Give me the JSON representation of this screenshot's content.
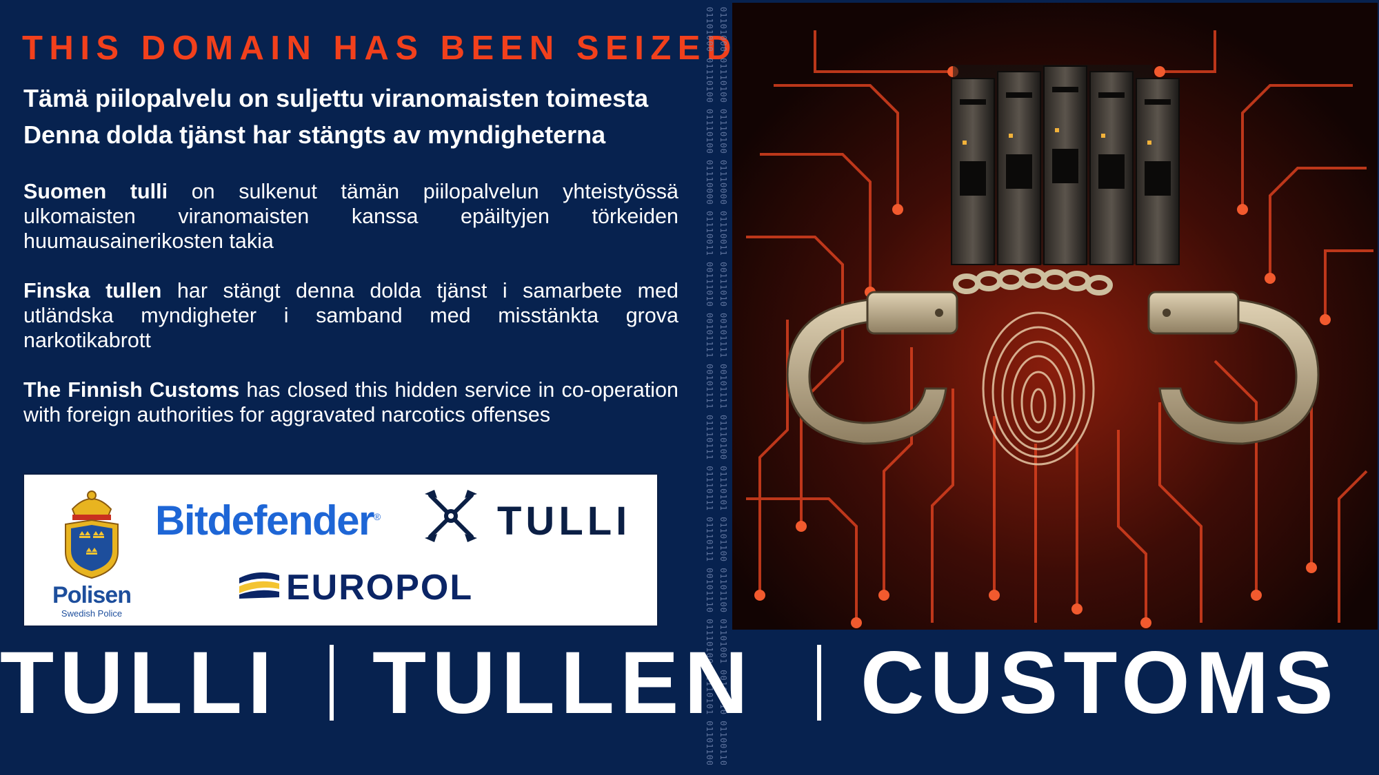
{
  "headline": "THIS DOMAIN HAS BEEN SEIZED",
  "subtitles": {
    "finnish": "Tämä piilopalvelu on suljettu viranomaisten toimesta",
    "swedish": "Denna dolda tjänst har stängts av myndigheterna"
  },
  "paragraphs": {
    "finnish": {
      "lead": "Suomen tulli",
      "body": " on sulkenut tämän piilopalvelun yhteistyössä ulkomaisten viranomaisten kanssa epäiltyjen törkeiden huumausainerikosten takia"
    },
    "swedish": {
      "lead": "Finska tullen",
      "body": " har stängt denna dolda tjänst i samarbete  med utländska myndigheter i samband med misstänkta grova narkotikabrott"
    },
    "english": {
      "lead": "The Finnish Customs",
      "body": " has closed this hidden service in co-operation with foreign authorities for aggravated narcotics offenses"
    }
  },
  "logos": {
    "police_name": "Polisen",
    "police_sub": "Swedish Police",
    "bitdefender": "Bitdefender",
    "bitdefender_mark": "®",
    "tulli": "TULLI",
    "europol": "EUROPOL"
  },
  "binary": {
    "line1": "01101000 01110100 01110100 01110000 01110011 00111010 00101111 00101111 01110111 01110111 01110111 00101110 01110100 01110101 01101100 01101100 01101001 00101110 01100110 01101001",
    "line2": "01101000 01110100 01110100 01110000 01110011 00111010 00101111 00101111 01110100 01110101 01101100 01101100 01101001 00101110 01100110 01101001 00101111 01100101 01101110 00101111"
  },
  "image": {
    "depicts": [
      "server-rack",
      "handcuffs",
      "fingerprint",
      "circuit-board"
    ]
  },
  "footer": {
    "word1": "TULLI",
    "word2": "TULLEN",
    "word3": "CUSTOMS"
  },
  "colors": {
    "background": "#07224f",
    "headline": "#f2401c",
    "circuit": "#d8401f"
  }
}
